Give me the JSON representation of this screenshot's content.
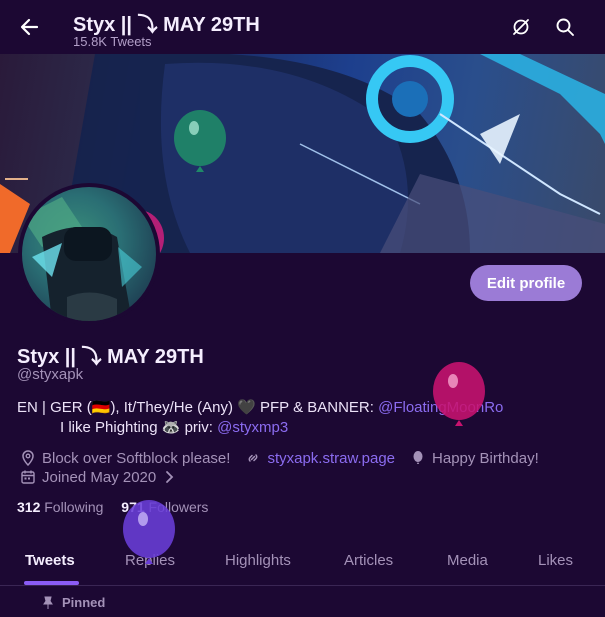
{
  "header": {
    "title": "Styx || ⤵ MAY 29TH",
    "tweet_count": "15.8K Tweets",
    "back_icon": "arrow-left-icon",
    "icons": [
      "sync-disabled-icon",
      "search-icon"
    ]
  },
  "profile": {
    "edit_button": "Edit profile",
    "name": "Styx || ⤵ MAY 29TH",
    "handle": "@styxapk",
    "bio_line1_prefix": "EN | GER (",
    "bio_line1_flag": "🇩🇪",
    "bio_line1_mid": "), It/They/He (Any) ",
    "bio_line1_heart": "🖤",
    "bio_line1_rest": " PFP & BANNER: ",
    "bio_line1_link": "@FloatingMoonRo",
    "bio_line2_prefix": "I like Phighting ",
    "bio_line2_emoji": "🦝",
    "bio_line2_mid": " priv: ",
    "bio_line2_link": "@styxmp3",
    "location": "Block over Softblock please!",
    "website": "styxapk.straw.page",
    "birthday": "Happy Birthday!",
    "joined": "Joined May 2020",
    "following_count": "312",
    "following_label": "Following",
    "followers_count": "971",
    "followers_label": "Followers"
  },
  "tabs": [
    "Tweets",
    "Replies",
    "Highlights",
    "Articles",
    "Media",
    "Likes"
  ],
  "pinned_label": "Pinned",
  "colors": {
    "background": "#1c0833",
    "accent": "#8b5cf6",
    "link": "#8b6cf0",
    "edit_button": "#9b7bd6",
    "muted": "#a492b8"
  }
}
